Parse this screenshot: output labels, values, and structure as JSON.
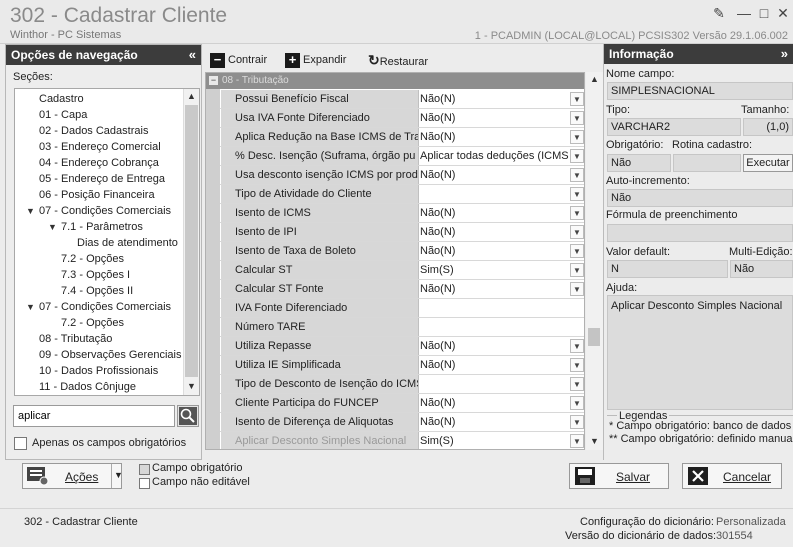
{
  "window": {
    "title": "302 - Cadastrar Cliente",
    "subtitle": "Winthor - PC Sistemas",
    "version_info": "1 - PCADMIN (LOCAL@LOCAL)   PCSIS302   Versão  29.1.06.002"
  },
  "nav": {
    "header": "Opções de navegação",
    "sections_label": "Seções:",
    "items": [
      {
        "label": "Cadastro",
        "level": 0,
        "arrow": ""
      },
      {
        "label": "01 - Capa",
        "level": 0,
        "arrow": ""
      },
      {
        "label": "02 - Dados Cadastrais",
        "level": 0,
        "arrow": ""
      },
      {
        "label": "03 - Endereço Comercial",
        "level": 0,
        "arrow": ""
      },
      {
        "label": "04 - Endereço Cobrança",
        "level": 0,
        "arrow": ""
      },
      {
        "label": "05 - Endereço de Entrega",
        "level": 0,
        "arrow": ""
      },
      {
        "label": "06 - Posição Financeira",
        "level": 0,
        "arrow": ""
      },
      {
        "label": "07 - Condições Comerciais",
        "level": 0,
        "arrow": "v"
      },
      {
        "label": "7.1 - Parâmetros",
        "level": 1,
        "arrow": "v"
      },
      {
        "label": "Dias de atendimento",
        "level": 2,
        "arrow": ""
      },
      {
        "label": "7.2 - Opções",
        "level": 1,
        "arrow": ""
      },
      {
        "label": "7.3 - Opções I",
        "level": 1,
        "arrow": ""
      },
      {
        "label": "7.4 - Opções II",
        "level": 1,
        "arrow": ""
      },
      {
        "label": "07 - Condições Comerciais",
        "level": 0,
        "arrow": "v"
      },
      {
        "label": "7.2 - Opções",
        "level": 1,
        "arrow": ""
      },
      {
        "label": "08 - Tributação",
        "level": 0,
        "arrow": ""
      },
      {
        "label": "09 - Observações Gerenciais",
        "level": 0,
        "arrow": ""
      },
      {
        "label": "10 - Dados Profissionais",
        "level": 0,
        "arrow": ""
      },
      {
        "label": "11 - Dados Cônjuge",
        "level": 0,
        "arrow": ""
      }
    ],
    "search_value": "aplicar",
    "required_only_label": "Apenas os campos obrigatórios"
  },
  "toolbar": {
    "contrair": "Contrair",
    "expandir": "Expandir",
    "restaurar": "Restaurar"
  },
  "grid": {
    "group_title": "08 - Tributação",
    "rows": [
      {
        "label": "Possui Benefício Fiscal",
        "value": "Não(N)",
        "dropdown": true
      },
      {
        "label": "Usa IVA Fonte Diferenciado",
        "value": "Não(N)",
        "dropdown": true
      },
      {
        "label": "Aplica Redução na Base ICMS de Tran",
        "value": "Não(N)",
        "dropdown": true
      },
      {
        "label": "% Desc. Isenção (Suframa, órgão pu",
        "value": "Aplicar todas deduções (ICMS e",
        "dropdown": true
      },
      {
        "label": "Usa desconto isenção ICMS por produ",
        "value": "Não(N)",
        "dropdown": true
      },
      {
        "label": "Tipo de Atividade do Cliente",
        "value": "",
        "dropdown": true
      },
      {
        "label": "Isento de ICMS",
        "value": "Não(N)",
        "dropdown": true
      },
      {
        "label": "Isento de IPI",
        "value": "Não(N)",
        "dropdown": true
      },
      {
        "label": "Isento de Taxa de Boleto",
        "value": "Não(N)",
        "dropdown": true
      },
      {
        "label": "Calcular ST",
        "value": "Sim(S)",
        "dropdown": true
      },
      {
        "label": "Calcular ST Fonte",
        "value": "Não(N)",
        "dropdown": true
      },
      {
        "label": "IVA Fonte Diferenciado",
        "value": "",
        "dropdown": false
      },
      {
        "label": "Número TARE",
        "value": "",
        "dropdown": false
      },
      {
        "label": "Utiliza Repasse",
        "value": "Não(N)",
        "dropdown": true
      },
      {
        "label": "Utiliza IE Simplificada",
        "value": "Não(N)",
        "dropdown": true
      },
      {
        "label": "Tipo de Desconto de Isenção do ICMS",
        "value": "",
        "dropdown": true
      },
      {
        "label": "Cliente Participa do FUNCEP",
        "value": "Não(N)",
        "dropdown": true
      },
      {
        "label": "Isento de Diferença de Aliquotas",
        "value": "Não(N)",
        "dropdown": true
      },
      {
        "label": "Aplicar Desconto Simples Nacional",
        "value": "Sim(S)",
        "dropdown": true,
        "disabled": true
      }
    ]
  },
  "info": {
    "header": "Informação",
    "nome_campo_label": "Nome campo:",
    "nome_campo": "SIMPLESNACIONAL",
    "tipo_label": "Tipo:",
    "tipo": "VARCHAR2",
    "tamanho_label": "Tamanho:",
    "tamanho": "(1,0)",
    "obrigatorio_label": "Obrigatório:",
    "obrigatorio": "Não",
    "rotina_label": "Rotina cadastro:",
    "rotina": "",
    "executar": "Executar",
    "autoinc_label": "Auto-incremento:",
    "autoinc": "Não",
    "formula_label": "Fórmula de preenchimento",
    "formula": "",
    "default_label": "Valor default:",
    "default": "N",
    "multi_label": "Multi-Edição:",
    "multi": "Não",
    "ajuda_label": "Ajuda:",
    "ajuda": "Aplicar Desconto Simples Nacional",
    "legend_title": "Legendas",
    "legend_1": "* Campo obrigatório: banco de dados",
    "legend_2": "** Campo obrigatório: definido manual"
  },
  "bottom": {
    "acoes": "Ações",
    "campo_obrigatorio": "Campo obrigatório",
    "campo_nao_editavel": "Campo não editável",
    "salvar": "Salvar",
    "cancelar": "Cancelar"
  },
  "status": {
    "left": "302 - Cadastrar Cliente",
    "config_label": "Configuração do dicionário:",
    "config_value": "Personalizada",
    "versao_label": "Versão do dicionário de dados:",
    "versao_value": "301554"
  }
}
